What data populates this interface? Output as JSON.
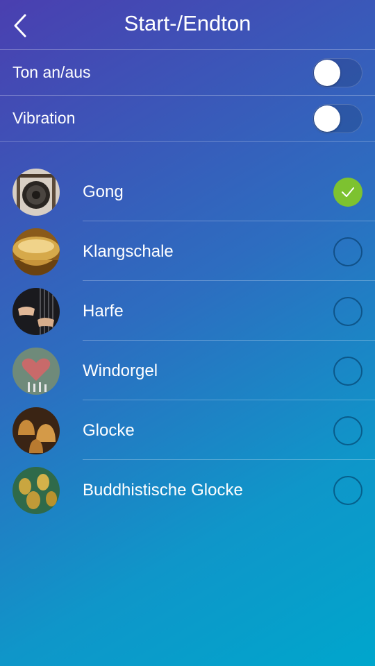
{
  "header": {
    "title": "Start-/Endton",
    "back_icon": "chevron-left-icon"
  },
  "settings": [
    {
      "label": "Ton an/aus",
      "enabled": false
    },
    {
      "label": "Vibration",
      "enabled": false
    }
  ],
  "sounds": [
    {
      "label": "Gong",
      "selected": true,
      "thumb": "gong-thumbnail"
    },
    {
      "label": "Klangschale",
      "selected": false,
      "thumb": "singing-bowl-thumbnail"
    },
    {
      "label": "Harfe",
      "selected": false,
      "thumb": "harp-thumbnail"
    },
    {
      "label": "Windorgel",
      "selected": false,
      "thumb": "wind-chime-thumbnail"
    },
    {
      "label": "Glocke",
      "selected": false,
      "thumb": "bells-thumbnail"
    },
    {
      "label": "Buddhistische Glocke",
      "selected": false,
      "thumb": "buddhist-bells-thumbnail"
    }
  ],
  "colors": {
    "accent_check": "#7dc230"
  }
}
